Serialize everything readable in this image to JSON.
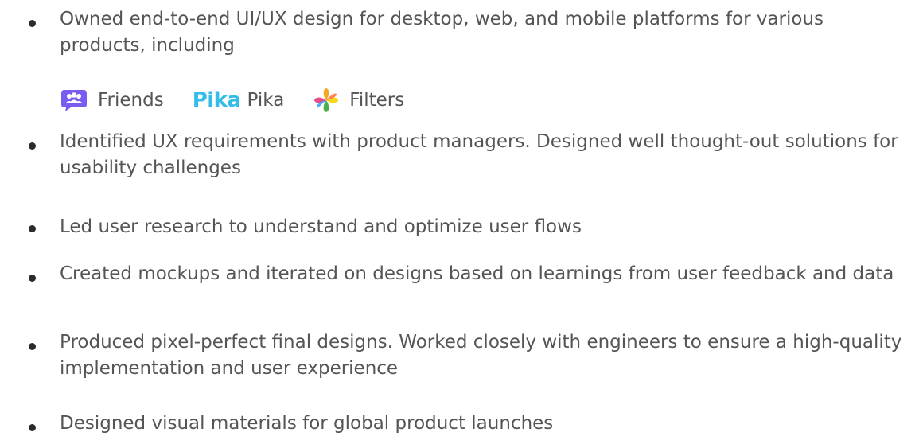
{
  "bullets": [
    {
      "text": "Owned end-to-end UI/UX design for desktop, web, and mobile platforms for various products, including"
    },
    {
      "text": "Identified UX requirements with product managers. Designed well thought-out solutions for usability challenges"
    },
    {
      "text": "Led user research to understand and optimize user flows"
    },
    {
      "text": "Created mockups and iterated on designs based on learnings from user feedback and data"
    },
    {
      "text": "Produced pixel-perfect final designs. Worked closely with engineers to ensure a high-quality implementation and user experience"
    },
    {
      "text": "Designed visual materials for global product launches"
    }
  ],
  "products": [
    {
      "label": "Friends",
      "icon": "friends-chat-icon",
      "color": "#7b5cf0"
    },
    {
      "label": "Pika",
      "logo_text": "Pika",
      "icon": "pika-logo",
      "color": "#33bde8"
    },
    {
      "label": "Filters",
      "icon": "filters-star-icon",
      "color": "#f5a623"
    }
  ]
}
